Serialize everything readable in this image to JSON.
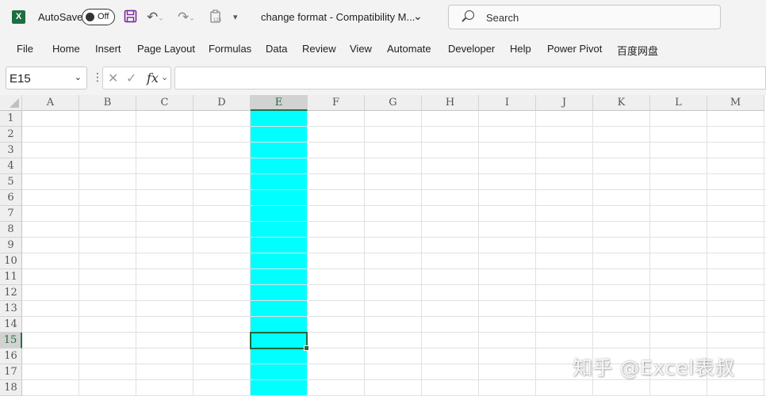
{
  "titlebar": {
    "app_icon": "excel-icon",
    "autosave_label": "AutoSave",
    "autosave_state": "Off",
    "doc_title": "change format  -  Compatibility M...",
    "search_placeholder": "Search"
  },
  "ribbon": {
    "tabs": [
      "File",
      "Home",
      "Insert",
      "Page Layout",
      "Formulas",
      "Data",
      "Review",
      "View",
      "Automate",
      "Developer",
      "Help",
      "Power Pivot",
      "百度网盘"
    ]
  },
  "formula_bar": {
    "name_box": "E15",
    "fx": "fx",
    "formula": ""
  },
  "grid": {
    "columns": [
      "A",
      "B",
      "C",
      "D",
      "E",
      "F",
      "G",
      "H",
      "I",
      "J",
      "K",
      "L",
      "M"
    ],
    "rows": [
      "1",
      "2",
      "3",
      "4",
      "5",
      "6",
      "7",
      "8",
      "9",
      "10",
      "11",
      "12",
      "13",
      "14",
      "15",
      "16",
      "17",
      "18"
    ],
    "selected_column": "E",
    "selected_row": "15",
    "fill_color": "#00ffff",
    "accent_color": "#217346"
  },
  "watermark": "知乎 @Excel表叔"
}
